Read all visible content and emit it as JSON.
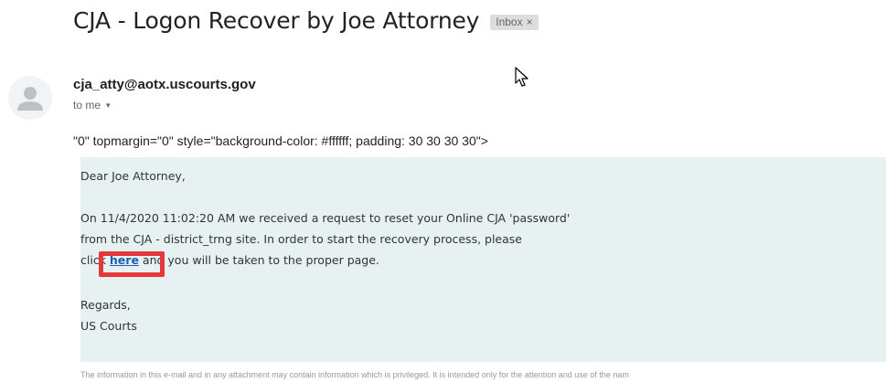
{
  "email": {
    "subject": "CJA - Logon Recover by Joe Attorney",
    "label": "Inbox",
    "label_remove": "×",
    "sender": "cja_atty@aotx.uscourts.gov",
    "recipient_text": "to me",
    "recipient_chevron": "▾",
    "raw_html_line": "\"0\" topmargin=\"0\" style=\"background-color: #ffffff; padding: 30 30 30 30\">",
    "body": {
      "greeting": "Dear Joe Attorney,",
      "line1": "On 11/4/2020 11:02:20 AM we received a request to reset your Online CJA 'password'",
      "line2": "from the CJA - district_trng site. In order to start the recovery process, please",
      "line3_prefix": "click ",
      "link_text": "here",
      "line3_suffix": " and you will be taken to the proper page.",
      "closing": "Regards,",
      "signature": "US Courts"
    },
    "disclaimer": "The information in this e-mail and in any attachment may contain information which is privileged. It is intended only for the attention and use of the nam"
  },
  "icons": {
    "avatar": "default-person-avatar",
    "cursor": "mouse-pointer-icon"
  },
  "colors": {
    "message_background": "#e8f1f2",
    "link": "#1a5fb4",
    "highlight_box": "#e5383b",
    "badge_background": "#dddddd"
  }
}
